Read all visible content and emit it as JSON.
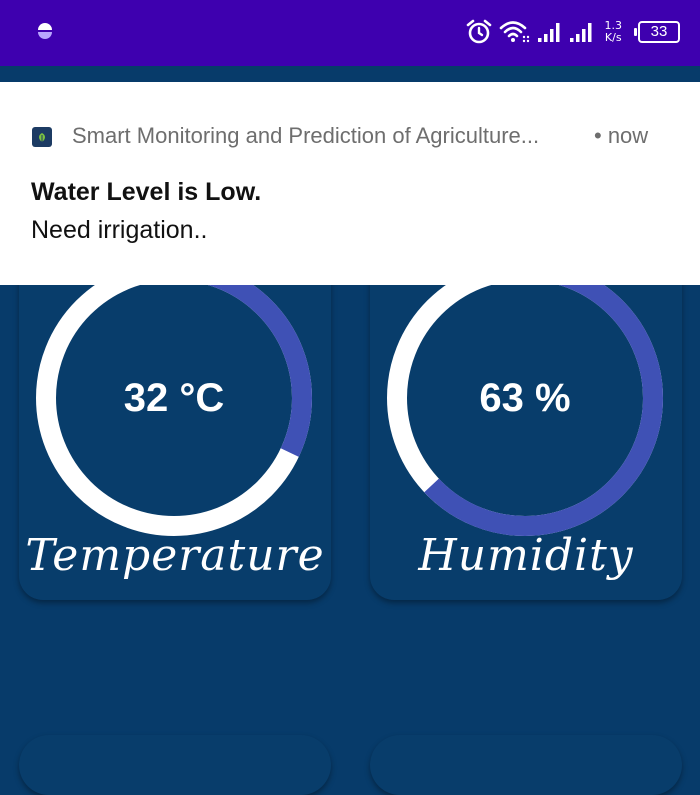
{
  "status_bar": {
    "net_speed_value": "1.3",
    "net_speed_unit": "K/s",
    "battery_level": "33",
    "icons": [
      "app-dot-icon",
      "alarm-icon",
      "wifi-icon",
      "signal-icon",
      "signal-icon"
    ],
    "background": "#3e00af"
  },
  "notification": {
    "app_name": "Smart Monitoring and Prediction of Agriculture...",
    "time": "• now",
    "title": "Water Level is Low.",
    "body": "Need irrigation.."
  },
  "cards": [
    {
      "value": "32 °C",
      "label": "Temperature",
      "progress": 0.32
    },
    {
      "value": "63 %",
      "label": "Humidity",
      "progress": 0.63
    }
  ],
  "colors": {
    "background": "#073b6a",
    "gauge_track": "#ffffff",
    "gauge_progress": "#3f51b5",
    "notification_background": "#ffffff"
  }
}
